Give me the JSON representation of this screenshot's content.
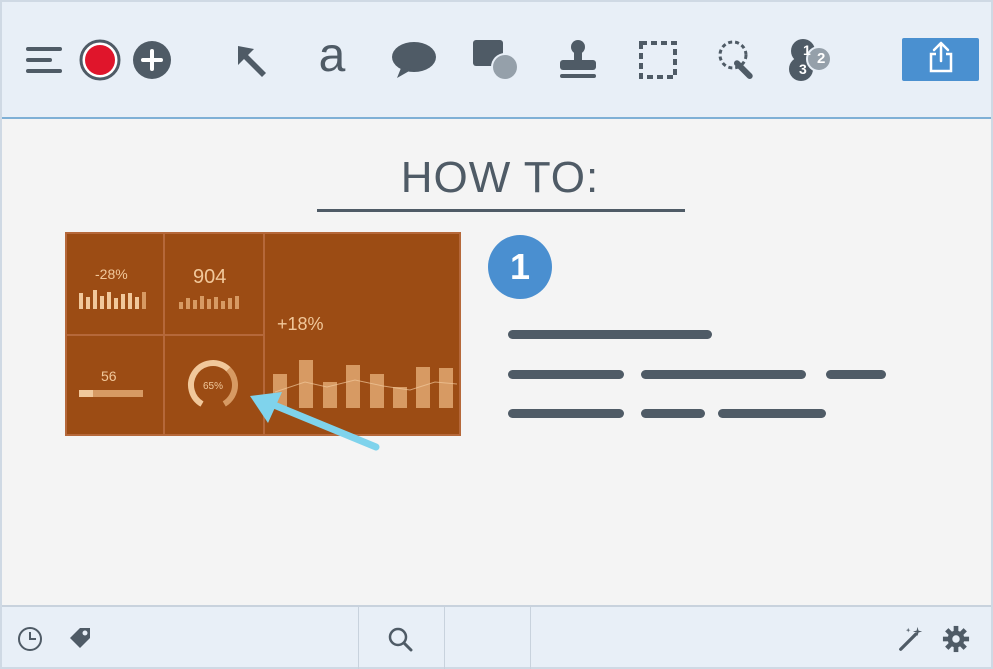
{
  "toolbar": {
    "icons": [
      {
        "name": "menu-icon"
      },
      {
        "name": "record-icon",
        "color": "#e0152b"
      },
      {
        "name": "add-icon"
      },
      {
        "name": "arrow-tool-icon"
      },
      {
        "name": "text-tool-icon",
        "glyph": "a"
      },
      {
        "name": "speech-bubble-icon"
      },
      {
        "name": "shape-tool-icon"
      },
      {
        "name": "stamp-tool-icon"
      },
      {
        "name": "selection-tool-icon"
      },
      {
        "name": "magic-wand-tool-icon"
      },
      {
        "name": "step-counter-icon",
        "glyph_a": "1",
        "glyph_b": "2",
        "glyph_c": "3"
      }
    ],
    "share": {
      "name": "share-icon"
    }
  },
  "canvas": {
    "title": "HOW TO:",
    "dashboard": {
      "stat_pct": "-28%",
      "stat_count": "904",
      "stat_growth": "+18%",
      "stat_value": "56",
      "gauge_label": "65%",
      "gauge_level": 0.65
    },
    "step_number": "1",
    "accent_color": "#4a8fd0",
    "arrow_color": "#7fd3ec"
  },
  "statusbar": {
    "icons": [
      "history-icon",
      "tag-icon",
      "search-icon",
      "magic-wand-icon",
      "settings-icon"
    ]
  }
}
